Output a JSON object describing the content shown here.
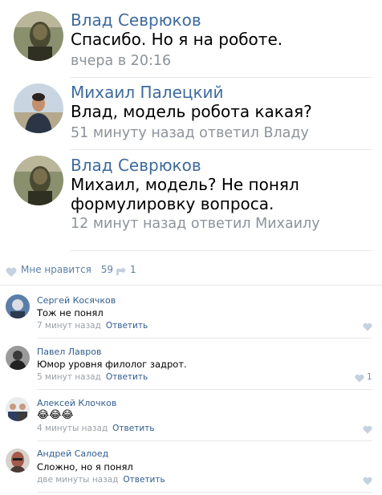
{
  "main_comments": [
    {
      "author": "Влад Севрюков",
      "text_lines": [
        "Спасибо. Но я на роботе."
      ],
      "meta": "вчера в 20:16"
    },
    {
      "author": "Михаил Палецкий",
      "text_lines": [
        "Влад, модель робота какая?"
      ],
      "meta": "51 минуту назад ответил Владу"
    },
    {
      "author": "Влад Севрюков",
      "text_lines": [
        "Михаил, модель? Не понял",
        "формулировку вопроса."
      ],
      "meta": "12 минут назад ответил Михаилу"
    }
  ],
  "likes_bar": {
    "like_label": "Мне нравится",
    "like_count": "59",
    "share_count": "1"
  },
  "comments": [
    {
      "author": "Сергей Косячков",
      "text": "Тож не понял",
      "time": "7 минут назад",
      "reply": "Ответить",
      "likes": ""
    },
    {
      "author": "Павел Лавров",
      "text": "Юмор уровня филолог задрот.",
      "time": "5 минут назад",
      "reply": "Ответить",
      "likes": "1"
    },
    {
      "author": "Алексей Клочков",
      "text": "😂😂😂",
      "time": "4 минуты назад",
      "reply": "Ответить",
      "likes": ""
    },
    {
      "author": "Андрей Салоед",
      "text": "Сложно, но я понял",
      "time": "две минуты назад",
      "reply": "Ответить",
      "likes": ""
    }
  ],
  "colors": {
    "link": "#2f5c8f",
    "name_large": "#3d6a9d",
    "meta": "#8b939b"
  }
}
